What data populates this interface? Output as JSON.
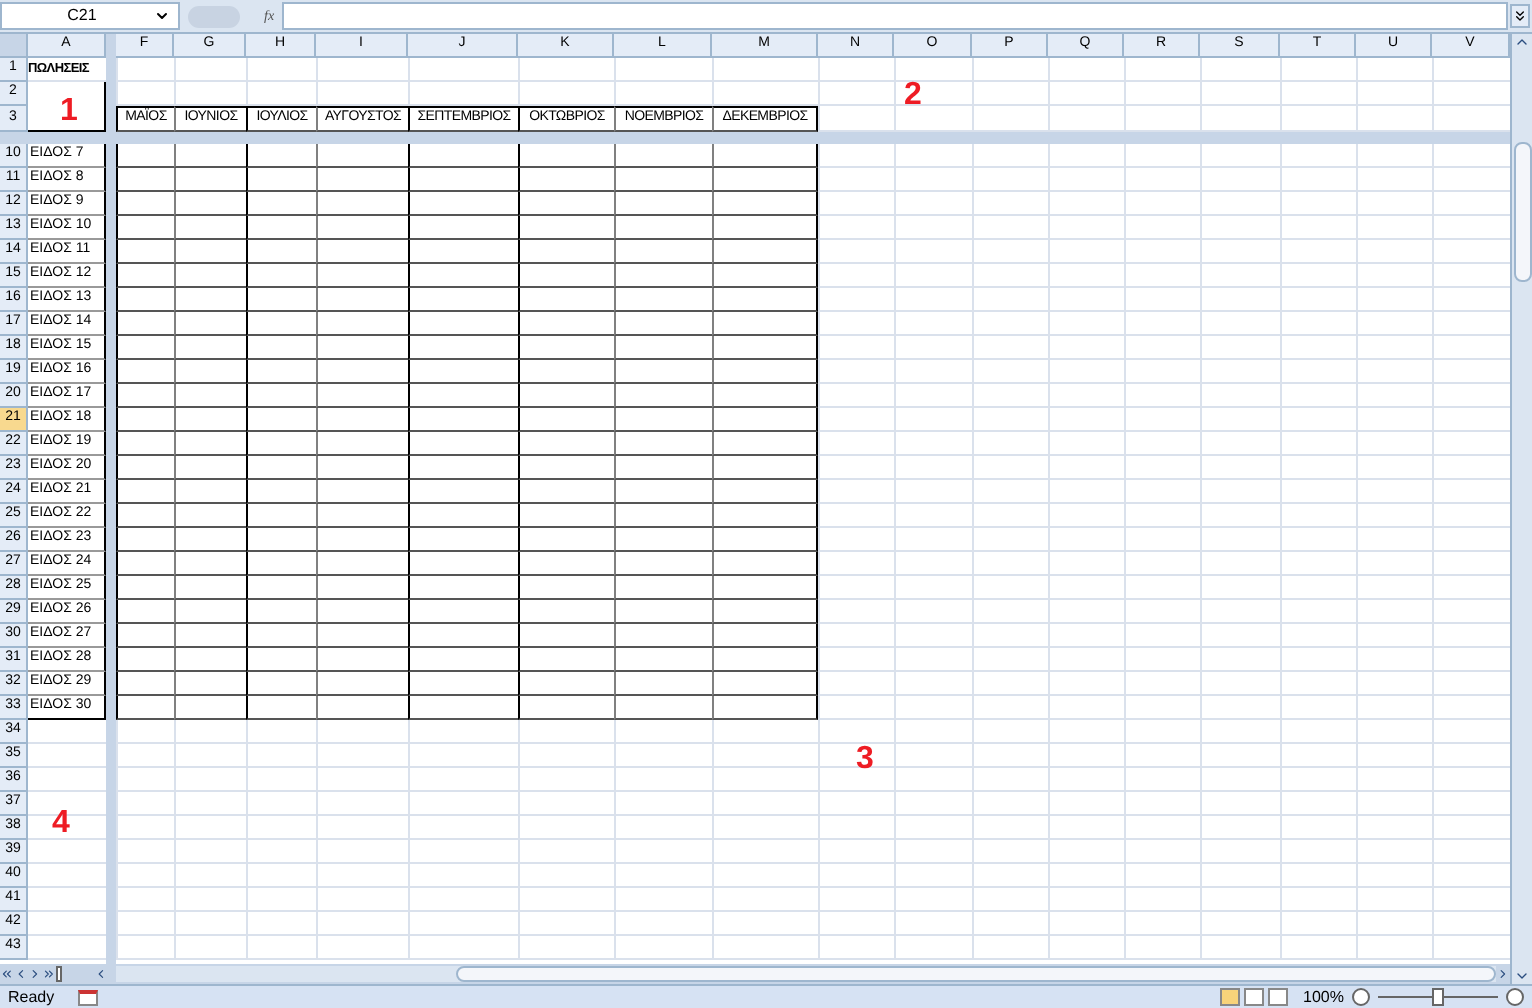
{
  "formula_bar": {
    "name_box": "C21",
    "fx": "fx"
  },
  "column_headers": {
    "frozen": [
      "A"
    ],
    "scroll": [
      "F",
      "G",
      "H",
      "I",
      "J",
      "K",
      "L",
      "M",
      "N",
      "O",
      "P",
      "Q",
      "R",
      "S",
      "T",
      "U",
      "V"
    ]
  },
  "top_rows": [
    {
      "number": "1",
      "cell_a": "ΠΩΛΗΣΕΙΣ",
      "cells": []
    },
    {
      "number": "2",
      "cells": []
    },
    {
      "number": "3",
      "cells": [
        "ΜΑΪΟΣ",
        "ΙΟΥΝΙΟΣ",
        "ΙΟΥΛΙΟΣ",
        "ΑΥΓΟΥΣΤΟΣ",
        "ΣΕΠΤΕΜΒΡΙΟΣ",
        "ΟΚΤΩΒΡΙΟΣ",
        "ΝΟΕΜΒΡΙΟΣ",
        "ΔΕΚΕΜΒΡΙΟΣ"
      ]
    }
  ],
  "rows": [
    {
      "number": "10",
      "cell_a": "ΕΙΔΟΣ 7",
      "selected": false
    },
    {
      "number": "11",
      "cell_a": "ΕΙΔΟΣ 8",
      "selected": false
    },
    {
      "number": "12",
      "cell_a": "ΕΙΔΟΣ 9",
      "selected": false
    },
    {
      "number": "13",
      "cell_a": "ΕΙΔΟΣ 10",
      "selected": false
    },
    {
      "number": "14",
      "cell_a": "ΕΙΔΟΣ 11",
      "selected": false
    },
    {
      "number": "15",
      "cell_a": "ΕΙΔΟΣ 12",
      "selected": false
    },
    {
      "number": "16",
      "cell_a": "ΕΙΔΟΣ 13",
      "selected": false
    },
    {
      "number": "17",
      "cell_a": "ΕΙΔΟΣ 14",
      "selected": false
    },
    {
      "number": "18",
      "cell_a": "ΕΙΔΟΣ 15",
      "selected": false
    },
    {
      "number": "19",
      "cell_a": "ΕΙΔΟΣ 16",
      "selected": false
    },
    {
      "number": "20",
      "cell_a": "ΕΙΔΟΣ 17",
      "selected": false
    },
    {
      "number": "21",
      "cell_a": "ΕΙΔΟΣ 18",
      "selected": true
    },
    {
      "number": "22",
      "cell_a": "ΕΙΔΟΣ 19",
      "selected": false
    },
    {
      "number": "23",
      "cell_a": "ΕΙΔΟΣ 20",
      "selected": false
    },
    {
      "number": "24",
      "cell_a": "ΕΙΔΟΣ 21",
      "selected": false
    },
    {
      "number": "25",
      "cell_a": "ΕΙΔΟΣ 22",
      "selected": false
    },
    {
      "number": "26",
      "cell_a": "ΕΙΔΟΣ 23",
      "selected": false
    },
    {
      "number": "27",
      "cell_a": "ΕΙΔΟΣ 24",
      "selected": false
    },
    {
      "number": "28",
      "cell_a": "ΕΙΔΟΣ 25",
      "selected": false
    },
    {
      "number": "29",
      "cell_a": "ΕΙΔΟΣ 26",
      "selected": false
    },
    {
      "number": "30",
      "cell_a": "ΕΙΔΟΣ 27",
      "selected": false
    },
    {
      "number": "31",
      "cell_a": "ΕΙΔΟΣ 28",
      "selected": false
    },
    {
      "number": "32",
      "cell_a": "ΕΙΔΟΣ 29",
      "selected": false
    },
    {
      "number": "33",
      "cell_a": "ΕΙΔΟΣ 30",
      "selected": false
    },
    {
      "number": "34",
      "selected": false
    },
    {
      "number": "35",
      "selected": false
    },
    {
      "number": "36",
      "selected": false
    },
    {
      "number": "37",
      "selected": false
    },
    {
      "number": "38",
      "selected": false
    },
    {
      "number": "39",
      "selected": false
    },
    {
      "number": "40",
      "selected": false
    },
    {
      "number": "41",
      "selected": false
    },
    {
      "number": "42",
      "selected": false
    },
    {
      "number": "43",
      "selected": false
    }
  ],
  "annotations": [
    "1",
    "2",
    "3",
    "4"
  ],
  "status_bar": {
    "status": "Ready",
    "zoom": "100%"
  },
  "zoom_slider": {
    "level": 0.5
  }
}
